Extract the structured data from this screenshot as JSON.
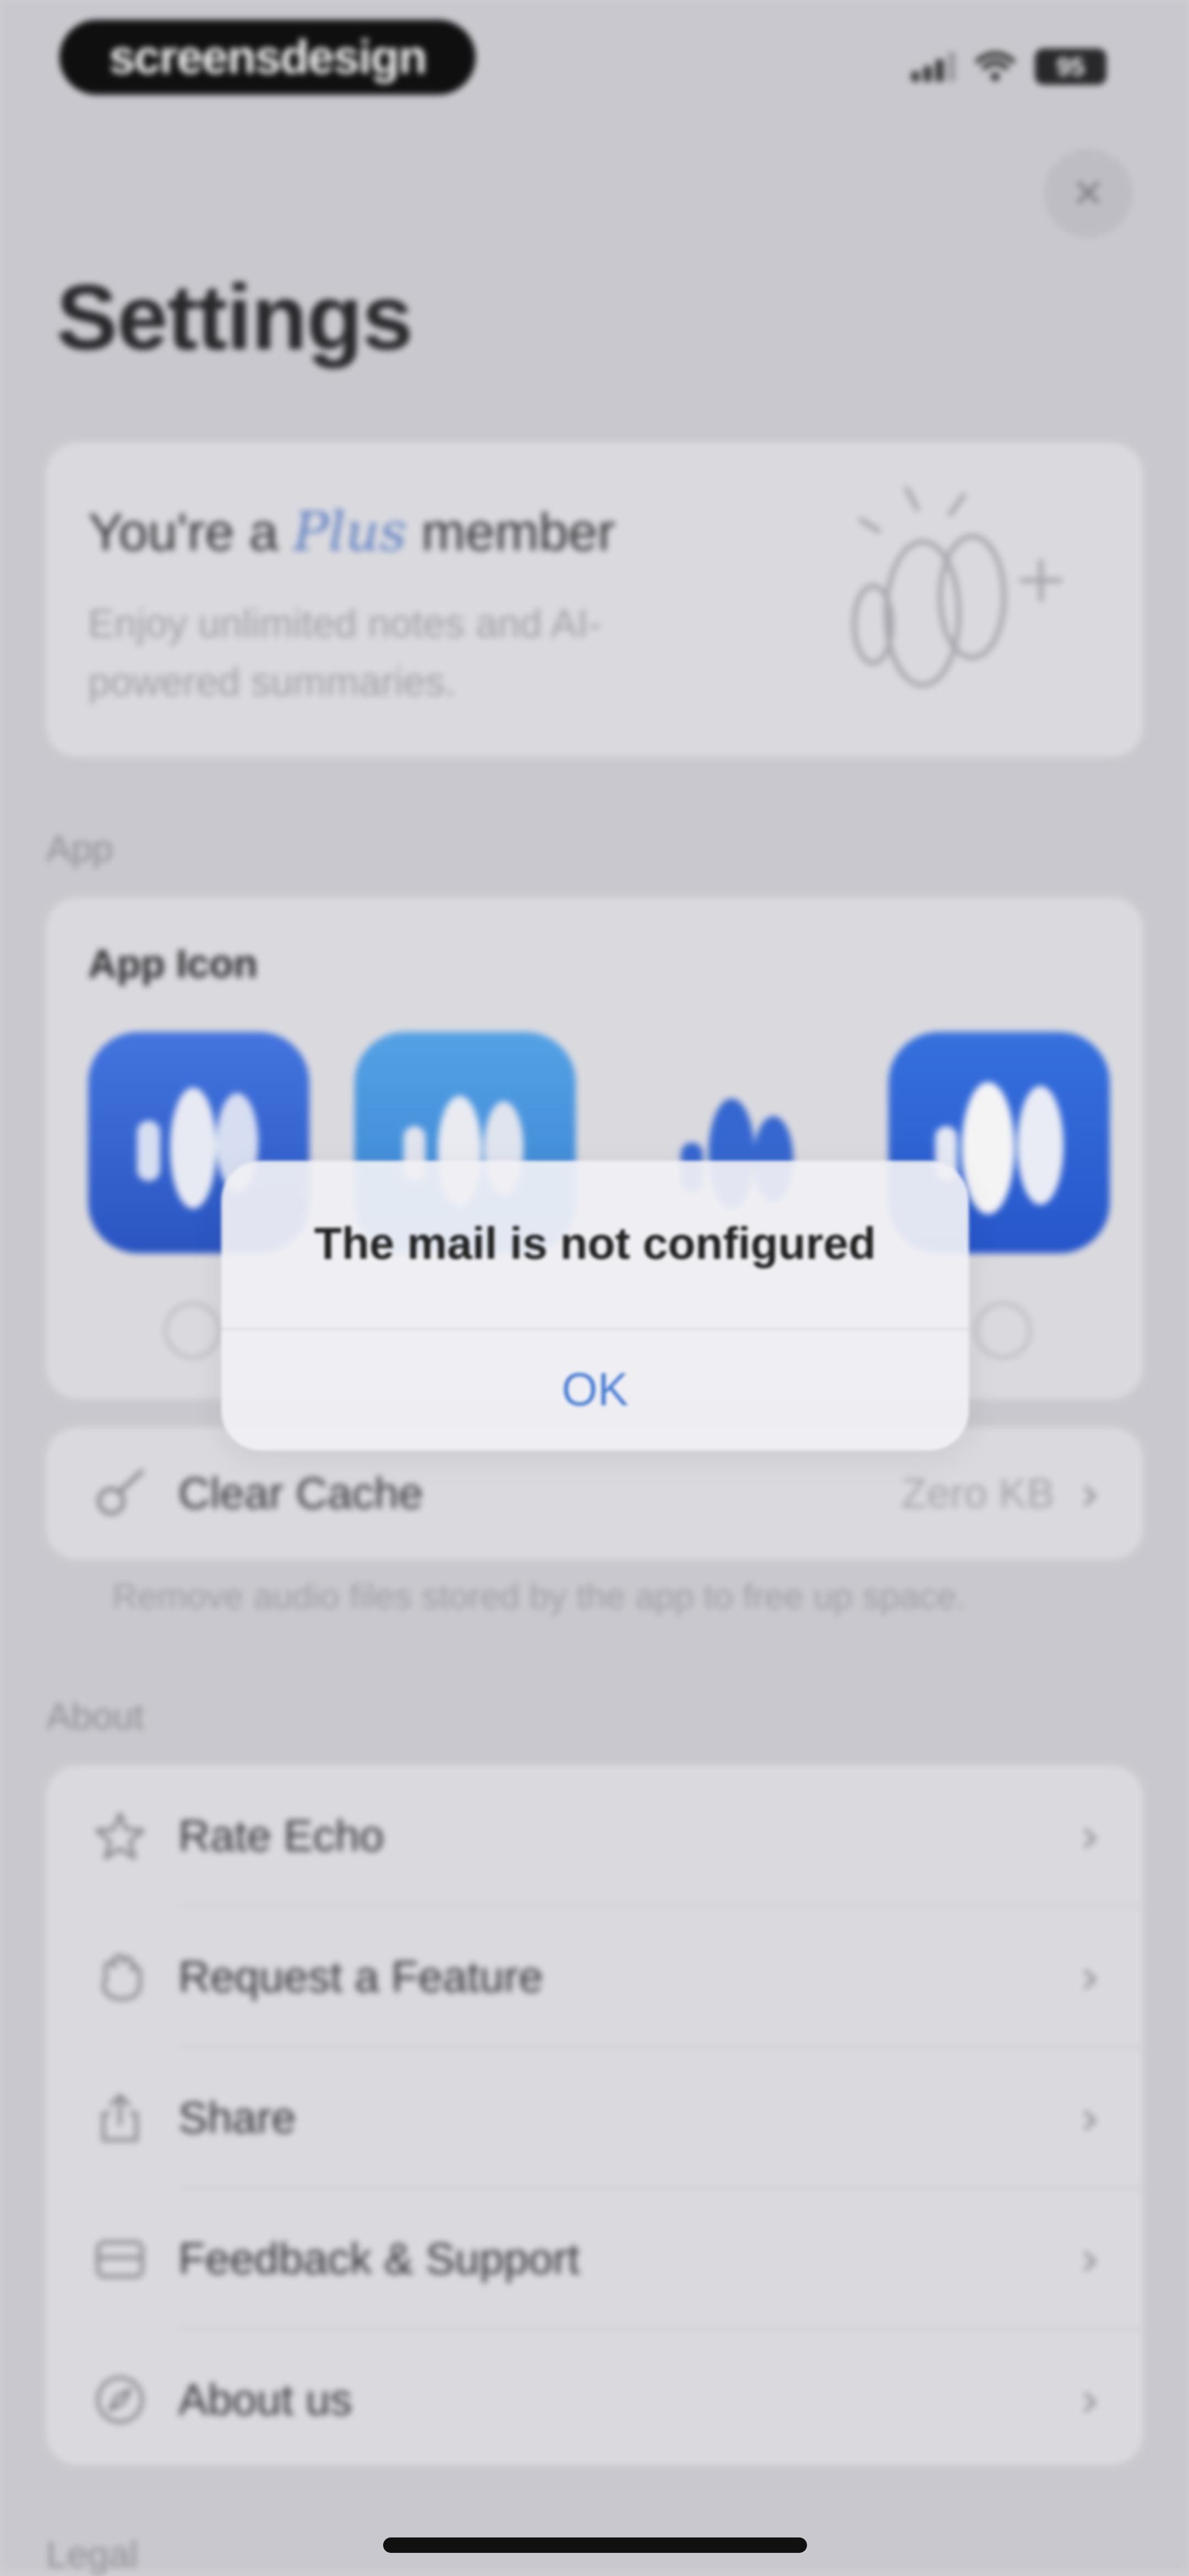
{
  "status_bar": {
    "brand": "screensdesign",
    "battery": "95"
  },
  "header": {
    "title": "Settings",
    "close_icon": "xmark-icon"
  },
  "membership": {
    "prefix": "You're a",
    "tier": "Plus",
    "suffix": "member",
    "subtitle": "Enjoy unlimited notes and AI-powered summaries."
  },
  "app_section": {
    "label": "App",
    "app_icon": {
      "title": "App Icon",
      "options": [
        {
          "style": "blue-gradient",
          "bg": "#2d64d8"
        },
        {
          "style": "light-blue",
          "bg": "#3d8fe2"
        },
        {
          "style": "transparent",
          "bg": "transparent"
        },
        {
          "style": "bright-blue",
          "bg": "#2767e0"
        }
      ]
    },
    "cache": {
      "label": "Clear Cache",
      "value": "Zero KB",
      "note": "Remove audio files stored by the app to free up space."
    }
  },
  "about_section": {
    "label": "About",
    "items": [
      {
        "label": "Rate Echo",
        "icon": "star-icon"
      },
      {
        "label": "Request a Feature",
        "icon": "hand-icon"
      },
      {
        "label": "Share",
        "icon": "share-icon"
      },
      {
        "label": "Feedback & Support",
        "icon": "envelope-icon"
      },
      {
        "label": "About us",
        "icon": "compass-icon"
      }
    ]
  },
  "legal_section": {
    "label": "Legal"
  },
  "alert": {
    "title": "The mail is not configured",
    "ok_label": "OK"
  },
  "colors": {
    "accent": "#4a7fd4",
    "icon_blue": "#2d64d8",
    "background": "#cfcfd4"
  }
}
